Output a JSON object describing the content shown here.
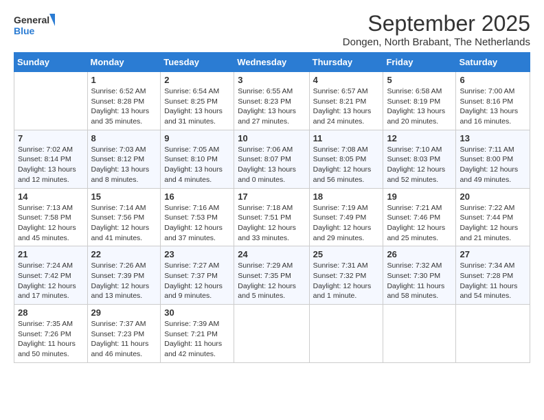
{
  "header": {
    "logo_line1": "General",
    "logo_line2": "Blue",
    "month": "September 2025",
    "location": "Dongen, North Brabant, The Netherlands"
  },
  "days_of_week": [
    "Sunday",
    "Monday",
    "Tuesday",
    "Wednesday",
    "Thursday",
    "Friday",
    "Saturday"
  ],
  "weeks": [
    [
      {
        "day": "",
        "sunrise": "",
        "sunset": "",
        "daylight": ""
      },
      {
        "day": "1",
        "sunrise": "Sunrise: 6:52 AM",
        "sunset": "Sunset: 8:28 PM",
        "daylight": "Daylight: 13 hours and 35 minutes."
      },
      {
        "day": "2",
        "sunrise": "Sunrise: 6:54 AM",
        "sunset": "Sunset: 8:25 PM",
        "daylight": "Daylight: 13 hours and 31 minutes."
      },
      {
        "day": "3",
        "sunrise": "Sunrise: 6:55 AM",
        "sunset": "Sunset: 8:23 PM",
        "daylight": "Daylight: 13 hours and 27 minutes."
      },
      {
        "day": "4",
        "sunrise": "Sunrise: 6:57 AM",
        "sunset": "Sunset: 8:21 PM",
        "daylight": "Daylight: 13 hours and 24 minutes."
      },
      {
        "day": "5",
        "sunrise": "Sunrise: 6:58 AM",
        "sunset": "Sunset: 8:19 PM",
        "daylight": "Daylight: 13 hours and 20 minutes."
      },
      {
        "day": "6",
        "sunrise": "Sunrise: 7:00 AM",
        "sunset": "Sunset: 8:16 PM",
        "daylight": "Daylight: 13 hours and 16 minutes."
      }
    ],
    [
      {
        "day": "7",
        "sunrise": "Sunrise: 7:02 AM",
        "sunset": "Sunset: 8:14 PM",
        "daylight": "Daylight: 13 hours and 12 minutes."
      },
      {
        "day": "8",
        "sunrise": "Sunrise: 7:03 AM",
        "sunset": "Sunset: 8:12 PM",
        "daylight": "Daylight: 13 hours and 8 minutes."
      },
      {
        "day": "9",
        "sunrise": "Sunrise: 7:05 AM",
        "sunset": "Sunset: 8:10 PM",
        "daylight": "Daylight: 13 hours and 4 minutes."
      },
      {
        "day": "10",
        "sunrise": "Sunrise: 7:06 AM",
        "sunset": "Sunset: 8:07 PM",
        "daylight": "Daylight: 13 hours and 0 minutes."
      },
      {
        "day": "11",
        "sunrise": "Sunrise: 7:08 AM",
        "sunset": "Sunset: 8:05 PM",
        "daylight": "Daylight: 12 hours and 56 minutes."
      },
      {
        "day": "12",
        "sunrise": "Sunrise: 7:10 AM",
        "sunset": "Sunset: 8:03 PM",
        "daylight": "Daylight: 12 hours and 52 minutes."
      },
      {
        "day": "13",
        "sunrise": "Sunrise: 7:11 AM",
        "sunset": "Sunset: 8:00 PM",
        "daylight": "Daylight: 12 hours and 49 minutes."
      }
    ],
    [
      {
        "day": "14",
        "sunrise": "Sunrise: 7:13 AM",
        "sunset": "Sunset: 7:58 PM",
        "daylight": "Daylight: 12 hours and 45 minutes."
      },
      {
        "day": "15",
        "sunrise": "Sunrise: 7:14 AM",
        "sunset": "Sunset: 7:56 PM",
        "daylight": "Daylight: 12 hours and 41 minutes."
      },
      {
        "day": "16",
        "sunrise": "Sunrise: 7:16 AM",
        "sunset": "Sunset: 7:53 PM",
        "daylight": "Daylight: 12 hours and 37 minutes."
      },
      {
        "day": "17",
        "sunrise": "Sunrise: 7:18 AM",
        "sunset": "Sunset: 7:51 PM",
        "daylight": "Daylight: 12 hours and 33 minutes."
      },
      {
        "day": "18",
        "sunrise": "Sunrise: 7:19 AM",
        "sunset": "Sunset: 7:49 PM",
        "daylight": "Daylight: 12 hours and 29 minutes."
      },
      {
        "day": "19",
        "sunrise": "Sunrise: 7:21 AM",
        "sunset": "Sunset: 7:46 PM",
        "daylight": "Daylight: 12 hours and 25 minutes."
      },
      {
        "day": "20",
        "sunrise": "Sunrise: 7:22 AM",
        "sunset": "Sunset: 7:44 PM",
        "daylight": "Daylight: 12 hours and 21 minutes."
      }
    ],
    [
      {
        "day": "21",
        "sunrise": "Sunrise: 7:24 AM",
        "sunset": "Sunset: 7:42 PM",
        "daylight": "Daylight: 12 hours and 17 minutes."
      },
      {
        "day": "22",
        "sunrise": "Sunrise: 7:26 AM",
        "sunset": "Sunset: 7:39 PM",
        "daylight": "Daylight: 12 hours and 13 minutes."
      },
      {
        "day": "23",
        "sunrise": "Sunrise: 7:27 AM",
        "sunset": "Sunset: 7:37 PM",
        "daylight": "Daylight: 12 hours and 9 minutes."
      },
      {
        "day": "24",
        "sunrise": "Sunrise: 7:29 AM",
        "sunset": "Sunset: 7:35 PM",
        "daylight": "Daylight: 12 hours and 5 minutes."
      },
      {
        "day": "25",
        "sunrise": "Sunrise: 7:31 AM",
        "sunset": "Sunset: 7:32 PM",
        "daylight": "Daylight: 12 hours and 1 minute."
      },
      {
        "day": "26",
        "sunrise": "Sunrise: 7:32 AM",
        "sunset": "Sunset: 7:30 PM",
        "daylight": "Daylight: 11 hours and 58 minutes."
      },
      {
        "day": "27",
        "sunrise": "Sunrise: 7:34 AM",
        "sunset": "Sunset: 7:28 PM",
        "daylight": "Daylight: 11 hours and 54 minutes."
      }
    ],
    [
      {
        "day": "28",
        "sunrise": "Sunrise: 7:35 AM",
        "sunset": "Sunset: 7:26 PM",
        "daylight": "Daylight: 11 hours and 50 minutes."
      },
      {
        "day": "29",
        "sunrise": "Sunrise: 7:37 AM",
        "sunset": "Sunset: 7:23 PM",
        "daylight": "Daylight: 11 hours and 46 minutes."
      },
      {
        "day": "30",
        "sunrise": "Sunrise: 7:39 AM",
        "sunset": "Sunset: 7:21 PM",
        "daylight": "Daylight: 11 hours and 42 minutes."
      },
      {
        "day": "",
        "sunrise": "",
        "sunset": "",
        "daylight": ""
      },
      {
        "day": "",
        "sunrise": "",
        "sunset": "",
        "daylight": ""
      },
      {
        "day": "",
        "sunrise": "",
        "sunset": "",
        "daylight": ""
      },
      {
        "day": "",
        "sunrise": "",
        "sunset": "",
        "daylight": ""
      }
    ]
  ]
}
